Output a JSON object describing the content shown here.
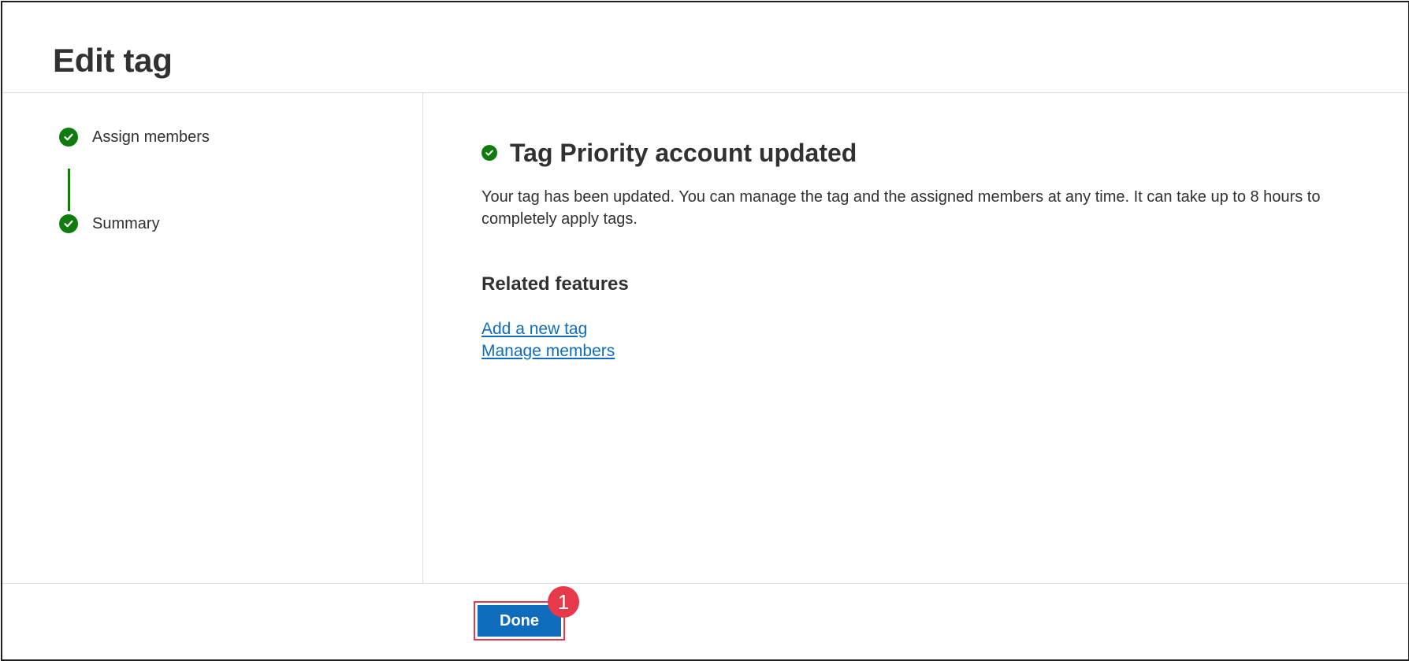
{
  "header": {
    "title": "Edit tag"
  },
  "steps": [
    {
      "label": "Assign members",
      "status": "completed",
      "icon": "checkmark-circle-icon"
    },
    {
      "label": "Summary",
      "status": "completed",
      "icon": "checkmark-circle-icon"
    }
  ],
  "main": {
    "success_icon": "checkmark-circle-icon",
    "success_title": "Tag Priority account updated",
    "description": "Your tag has been updated. You can manage the tag and the assigned members at any time. It can take up to 8 hours to completely apply tags.",
    "related_heading": "Related features",
    "links": [
      {
        "label": "Add a new tag"
      },
      {
        "label": "Manage members"
      }
    ]
  },
  "footer": {
    "done_label": "Done",
    "callout_number": "1"
  },
  "colors": {
    "success_green": "#107c10",
    "primary_blue": "#0f6cbd",
    "link_blue": "#0f6cbd",
    "callout_red": "#e8394a",
    "text": "#323130",
    "divider": "#e1dfdd"
  }
}
